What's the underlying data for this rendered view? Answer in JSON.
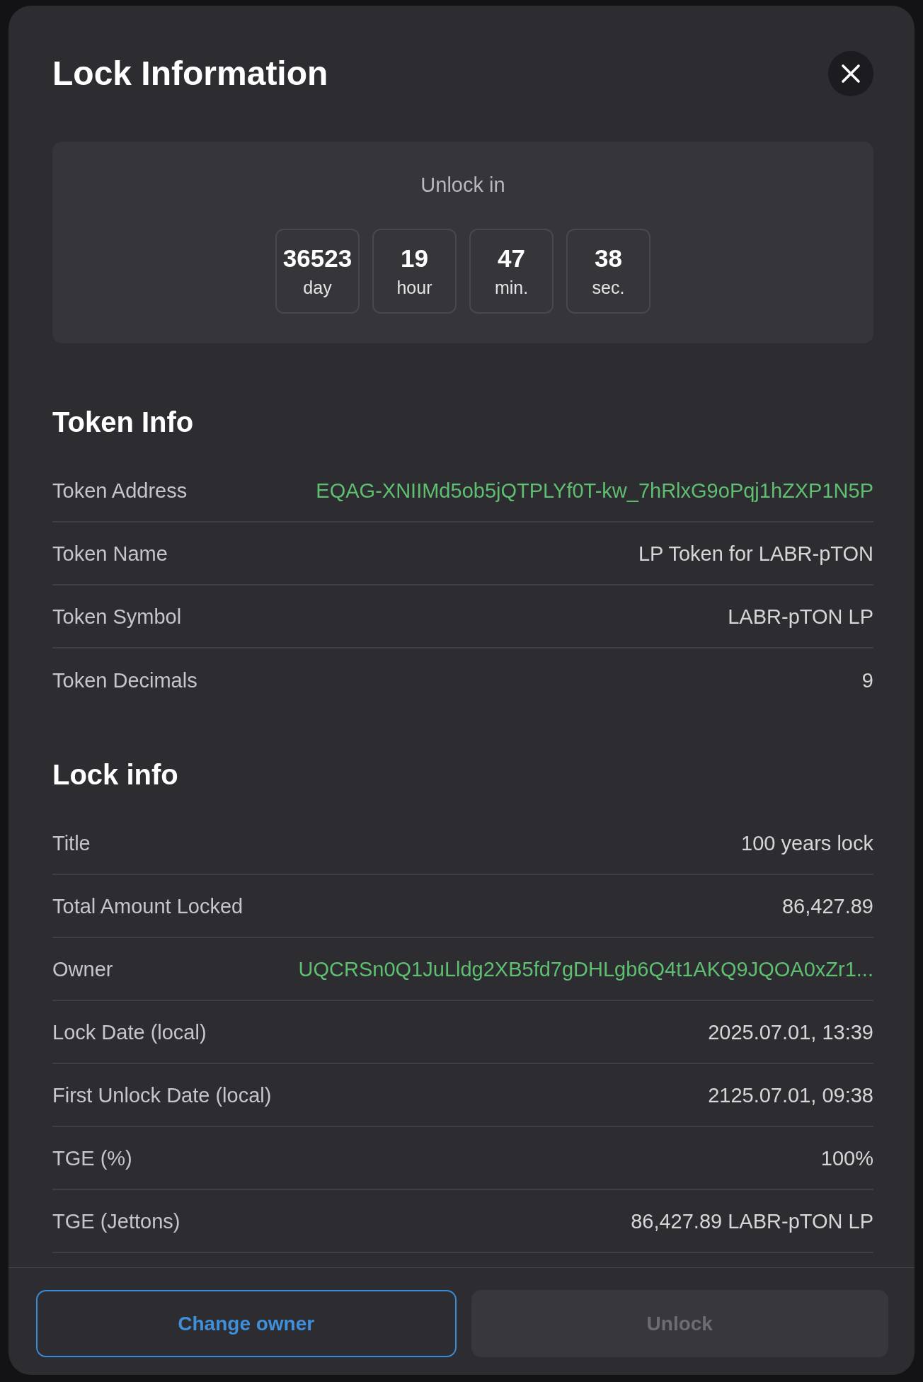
{
  "dialog": {
    "title": "Lock Information"
  },
  "countdown": {
    "label": "Unlock in",
    "units": [
      {
        "value": "36523",
        "unit": "day"
      },
      {
        "value": "19",
        "unit": "hour"
      },
      {
        "value": "47",
        "unit": "min."
      },
      {
        "value": "38",
        "unit": "sec."
      }
    ]
  },
  "sections": [
    {
      "heading": "Token Info",
      "rows": [
        {
          "label": "Token Address",
          "value": "EQAG-XNIIMd5ob5jQTPLYf0T-kw_7hRlxG9oPqj1hZXP1N5P",
          "kind": "link"
        },
        {
          "label": "Token Name",
          "value": "LP Token for LABR-pTON",
          "kind": "text"
        },
        {
          "label": "Token Symbol",
          "value": "LABR-pTON LP",
          "kind": "text"
        },
        {
          "label": "Token Decimals",
          "value": "9",
          "kind": "text"
        }
      ]
    },
    {
      "heading": "Lock info",
      "rows": [
        {
          "label": "Title",
          "value": "100 years lock",
          "kind": "text"
        },
        {
          "label": "Total Amount Locked",
          "value": "86,427.89",
          "kind": "text"
        },
        {
          "label": "Owner",
          "value": "UQCRSn0Q1JuLldg2XB5fd7gDHLgb6Q4t1AKQ9JQOA0xZr1...",
          "kind": "link"
        },
        {
          "label": "Lock Date (local)",
          "value": "2025.07.01, 13:39",
          "kind": "text"
        },
        {
          "label": "First Unlock Date (local)",
          "value": "2125.07.01, 09:38",
          "kind": "text"
        },
        {
          "label": "TGE (%)",
          "value": "100%",
          "kind": "text"
        },
        {
          "label": "TGE (Jettons)",
          "value": "86,427.89 LABR-pTON LP",
          "kind": "text"
        }
      ]
    }
  ],
  "buttons": [
    {
      "label": "Change owner",
      "disabled": false
    },
    {
      "label": "Unlock",
      "disabled": true
    }
  ]
}
